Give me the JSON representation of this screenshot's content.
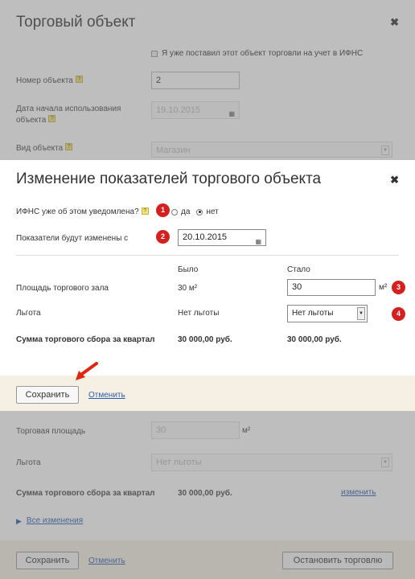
{
  "background": {
    "title": "Торговый объект",
    "checkbox_label": "Я уже поставил этот объект торговли на учет в ИФНС",
    "number_label": "Номер объекта",
    "number_value": "2",
    "start_date_label_1": "Дата начала использования",
    "start_date_label_2": "объекта",
    "start_date_value": "19.10.2015",
    "type_label": "Вид объекта",
    "type_value": "Магазин",
    "area_label": "Торговая площадь",
    "area_value": "30",
    "area_unit": "м²",
    "benefit_label": "Льгота",
    "benefit_value": "Нет льготы",
    "sum_label": "Сумма торгового сбора за квартал",
    "sum_value": "30 000,00 руб.",
    "change_link": "изменить",
    "all_changes_link": "Все изменения",
    "save_label": "Сохранить",
    "cancel_label": "Отменить",
    "stop_label": "Остановить торговлю"
  },
  "modal": {
    "title": "Изменение показателей торгового объекта",
    "ifns_label": "ИФНС уже об этом уведомлена?",
    "radio_yes": "да",
    "radio_no": "нет",
    "radio_selected": "нет",
    "change_date_label": "Показатели будут изменены с",
    "change_date_value": "20.10.2015",
    "col_was": "Было",
    "col_became": "Стало",
    "area_label": "Площадь торгового зала",
    "area_was": "30 м²",
    "area_new": "30",
    "area_unit": "м²",
    "benefit_label": "Льгота",
    "benefit_was": "Нет льготы",
    "benefit_new": "Нет льготы",
    "sum_label": "Сумма торгового сбора за квартал",
    "sum_was": "30 000,00 руб.",
    "sum_new": "30 000,00 руб.",
    "save_label": "Сохранить",
    "cancel_label": "Отменить"
  },
  "badges": [
    "1",
    "2",
    "3",
    "4"
  ],
  "colors": {
    "badge": "#d62020",
    "footer": "#f6efe3",
    "link": "#2a5db0",
    "arrow": "#e0260f"
  }
}
